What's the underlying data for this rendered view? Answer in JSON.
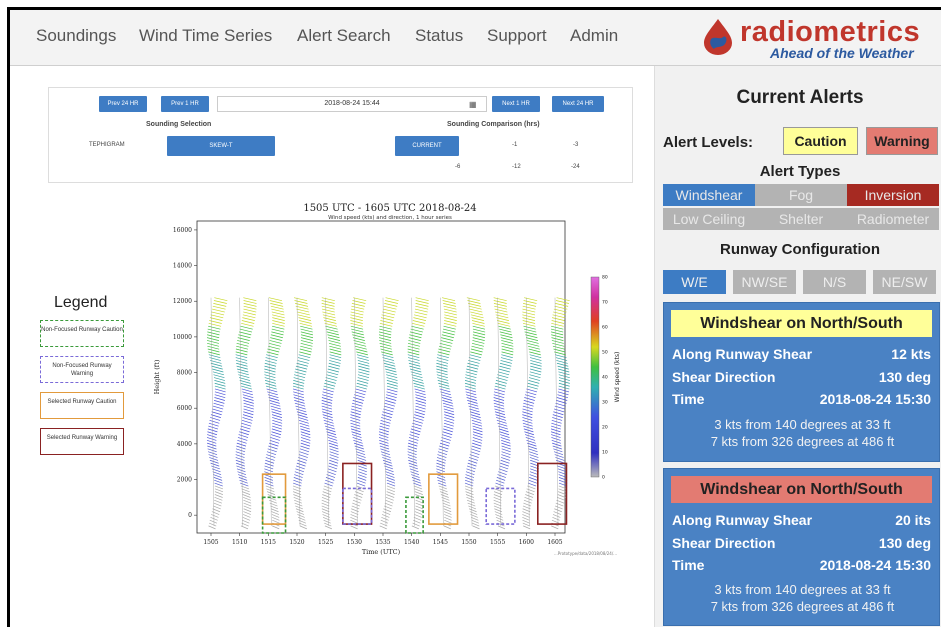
{
  "nav": {
    "items": [
      "Soundings",
      "Wind Time Series",
      "Alert Search",
      "Status",
      "Support",
      "Admin"
    ],
    "logo_word": "radiometrics",
    "logo_tagline": "Ahead of the Weather"
  },
  "sounding": {
    "prev24": "Prev 24 HR",
    "prev1": "Prev 1 HR",
    "datetime": "2018-08-24 15:44",
    "next1": "Next 1 HR",
    "next24": "Next 24 HR",
    "selection_label": "Sounding Selection",
    "tephigram": "TEPHIGRAM",
    "skewt": "SKEW-T",
    "comparison_label": "Sounding Comparison (hrs)",
    "current": "CURRENT",
    "comparisons": [
      "-1",
      "-3",
      "-6",
      "-12",
      "-24"
    ]
  },
  "legend": {
    "title": "Legend",
    "items": [
      {
        "label": "Non-Focused Runway Caution",
        "color": "#3a9a3a",
        "style": "dashed"
      },
      {
        "label": "Non-Focused Runway Warning",
        "color": "#7a6ad8",
        "style": "dashed"
      },
      {
        "label": "Selected Runway Caution",
        "color": "#e29a3c",
        "style": "solid"
      },
      {
        "label": "Selected Runway Warning",
        "color": "#8a2222",
        "style": "solid"
      }
    ]
  },
  "chart_data": {
    "type": "wind barb time series",
    "title": "1505 UTC  -  1605 UTC   2018-08-24",
    "subtitle": "Wind speed (kts) and direction, 1 hour series",
    "xlabel": "Time (UTC)",
    "ylabel": "Height (ft)",
    "colorbar_label": "Wind speed (kts)",
    "x_ticks": [
      "1505",
      "1510",
      "1515",
      "1520",
      "1525",
      "1530",
      "1535",
      "1540",
      "1545",
      "1550",
      "1555",
      "1600",
      "1605"
    ],
    "y_ticks": [
      0,
      2000,
      4000,
      6000,
      8000,
      10000,
      12000,
      14000,
      16000
    ],
    "ylim": [
      -1000,
      16500
    ],
    "colorbar_ticks": [
      0,
      10,
      20,
      30,
      40,
      50,
      60,
      70,
      80
    ],
    "colorbar_range": [
      0,
      80
    ],
    "column_times": [
      "1505",
      "1510",
      "1515",
      "1520",
      "1525",
      "1530",
      "1535",
      "1540",
      "1545",
      "1550",
      "1555",
      "1600",
      "1605"
    ],
    "profile_top_ft": 12200,
    "alert_boxes": [
      {
        "type": "Selected Runway Caution",
        "x_from": "1514",
        "x_to": "1518",
        "y_from": -500,
        "y_to": 2300
      },
      {
        "type": "Non-Focused Runway Caution",
        "x_from": "1514",
        "x_to": "1518",
        "y_from": -1000,
        "y_to": 1000
      },
      {
        "type": "Selected Runway Warning",
        "x_from": "1528",
        "x_to": "1533",
        "y_from": -500,
        "y_to": 2900
      },
      {
        "type": "Non-Focused Runway Warning",
        "x_from": "1528",
        "x_to": "1533",
        "y_from": -500,
        "y_to": 1500
      },
      {
        "type": "Non-Focused Runway Caution",
        "x_from": "1539",
        "x_to": "1542",
        "y_from": -1000,
        "y_to": 1000
      },
      {
        "type": "Selected Runway Caution",
        "x_from": "1543",
        "x_to": "1548",
        "y_from": -500,
        "y_to": 2300
      },
      {
        "type": "Non-Focused Runway Warning",
        "x_from": "1553",
        "x_to": "1558",
        "y_from": -500,
        "y_to": 1500
      },
      {
        "type": "Selected Runway Warning",
        "x_from": "1602",
        "x_to": "1607",
        "y_from": -500,
        "y_to": 2900
      }
    ],
    "footnote": "...Prototype/data/2018/08/24/..."
  },
  "alerts_panel": {
    "title": "Current Alerts",
    "levels_label": "Alert Levels:",
    "caution": "Caution",
    "warning": "Warning",
    "types_label": "Alert Types",
    "types": [
      "Windshear",
      "Fog",
      "Inversion",
      "Low Ceiling",
      "Shelter",
      "Radiometer"
    ],
    "runway_label": "Runway Configuration",
    "runways": [
      "W/E",
      "NW/SE",
      "N/S",
      "NE/SW"
    ],
    "colors": {
      "caution": "#ffff99",
      "warning": "#e37b72",
      "active_blue": "#3d7cc4",
      "inactive_gray": "#b3b3b3",
      "inversion_red": "#a62a22"
    }
  },
  "alert_cards": [
    {
      "heading": "Windshear on North/South",
      "along_label": "Along Runway Shear",
      "along_value": "12 kts",
      "direction_label": "Shear Direction",
      "direction_value": "130 deg",
      "time_label": "Time",
      "time_value": "2018-08-24 15:30",
      "desc1": "3 kts from 140 degrees at 33 ft",
      "desc2": "7 kts from 326 degrees at 486 ft",
      "level": "caution"
    },
    {
      "heading": "Windshear on North/South",
      "along_label": "Along Runway Shear",
      "along_value": "20 its",
      "direction_label": "Shear Direction",
      "direction_value": "130 deg",
      "time_label": "Time",
      "time_value": "2018-08-24 15:30",
      "desc1": "3 kts from 140 degrees at 33 ft",
      "desc2": "7 kts from 326 degrees at 486 ft",
      "level": "warning"
    }
  ]
}
